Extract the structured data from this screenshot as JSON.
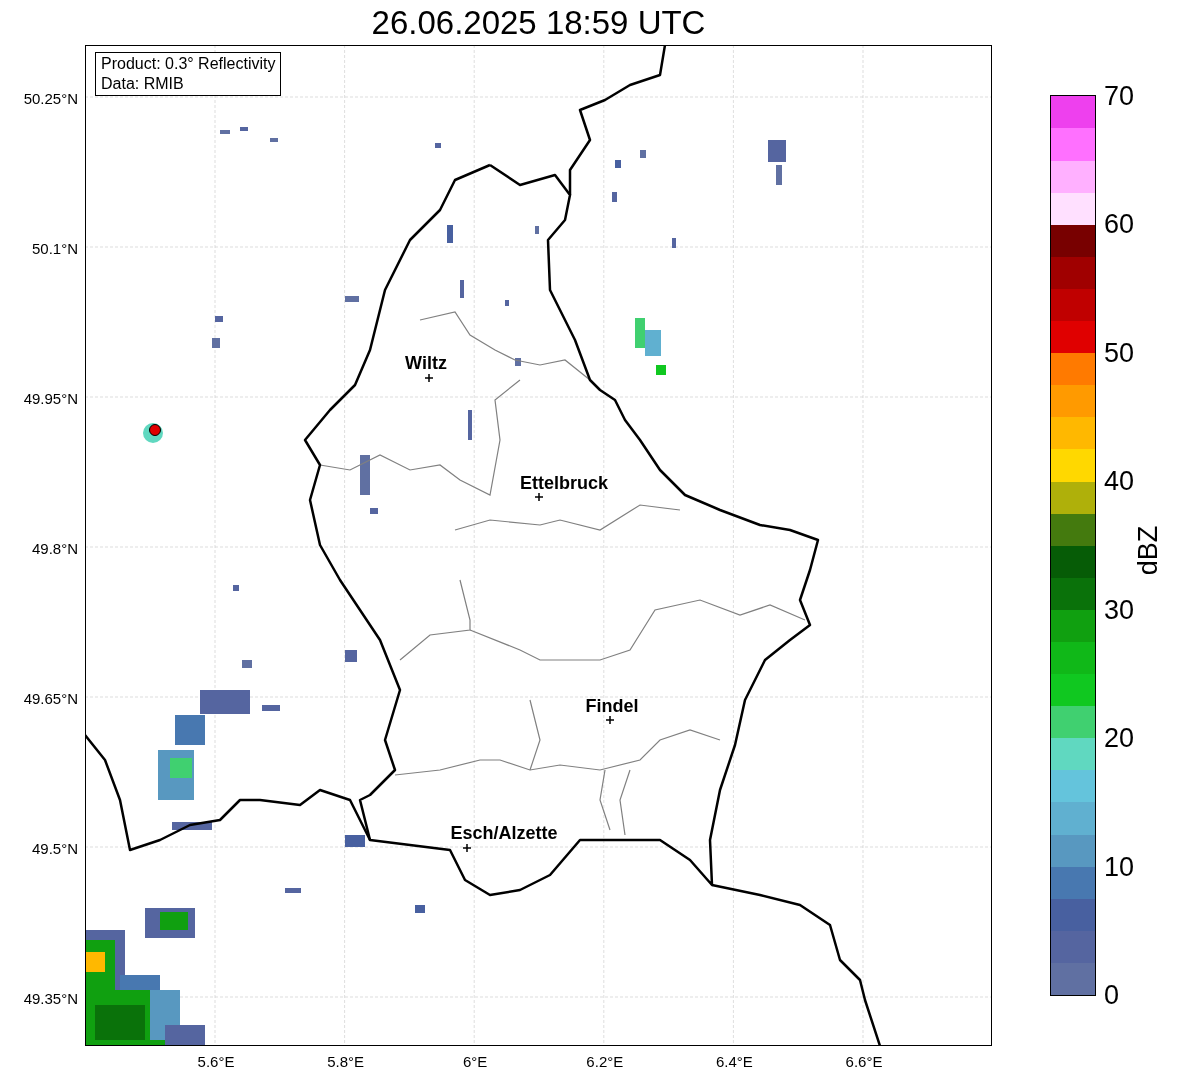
{
  "title": "26.06.2025 18:59 UTC",
  "info_box": {
    "lines": [
      "Product: 0.3° Reflectivity",
      "Data: RMIB"
    ]
  },
  "map": {
    "lat_ticks": [
      "50.25°N",
      "50.1°N",
      "49.95°N",
      "49.8°N",
      "49.65°N",
      "49.5°N",
      "49.35°N"
    ],
    "lon_ticks": [
      "5.6°E",
      "5.8°E",
      "6°E",
      "6.2°E",
      "6.4°E",
      "6.6°E"
    ],
    "places": [
      {
        "name": "Wiltz"
      },
      {
        "name": "Ettelbruck"
      },
      {
        "name": "Findel"
      },
      {
        "name": "Esch/Alzette"
      }
    ]
  },
  "colorbar": {
    "label": "dBZ",
    "ticks": [
      "70",
      "60",
      "50",
      "40",
      "30",
      "20",
      "10",
      "0"
    ],
    "bins": [
      {
        "color": "#6070a2"
      },
      {
        "color": "#5565a0"
      },
      {
        "color": "#4860a0"
      },
      {
        "color": "#4878b0"
      },
      {
        "color": "#5898c0"
      },
      {
        "color": "#60b0d0"
      },
      {
        "color": "#64c4dc"
      },
      {
        "color": "#60d8c0"
      },
      {
        "color": "#40d070"
      },
      {
        "color": "#10c820"
      },
      {
        "color": "#10b818"
      },
      {
        "color": "#10a010"
      },
      {
        "color": "#0a720a"
      },
      {
        "color": "#065c06"
      },
      {
        "color": "#447a0e"
      },
      {
        "color": "#afb00a"
      },
      {
        "color": "#ffd800"
      },
      {
        "color": "#ffb800"
      },
      {
        "color": "#ff9a00"
      },
      {
        "color": "#ff7a00"
      },
      {
        "color": "#e00000"
      },
      {
        "color": "#c00000"
      },
      {
        "color": "#a00000"
      },
      {
        "color": "#780000"
      },
      {
        "color": "#ffe0ff"
      },
      {
        "color": "#ffb0ff"
      },
      {
        "color": "#ff70ff"
      },
      {
        "color": "#ee40ee"
      }
    ]
  }
}
